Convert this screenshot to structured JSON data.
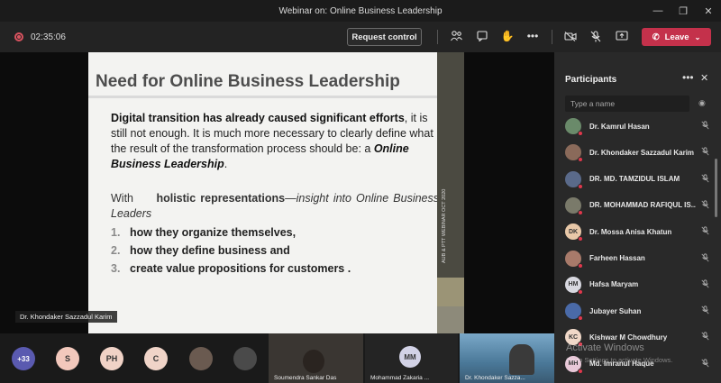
{
  "window": {
    "title": "Webinar on: Online Business Leadership"
  },
  "toolbar": {
    "timer": "02:35:06",
    "request_control": "Request control",
    "leave": "Leave"
  },
  "slide": {
    "title": "Need  for Online Business Leadership",
    "para1_bold": "Digital transition has already caused significant efforts",
    "para1_rest": ", it is still not enough. It is much more necessary to clearly define what the result of the transformation process should be: a ",
    "para1_italic": "Online Business Leadership",
    "para1_end": ".",
    "para2_with": "With",
    "para2_bold": "holistic representations",
    "para2_dash": "—",
    "para2_italic": "insight into Online Business Leaders",
    "bullets": [
      {
        "num": "1.",
        "text": "how they organize themselves,"
      },
      {
        "num": "2.",
        "text": "how they define business and"
      },
      {
        "num": "3.",
        "text": "create value propositions for customers ."
      }
    ],
    "side_text": "AUB & PTT WEBINAR OCT 2020"
  },
  "presenter_label": "Dr. Khondaker Sazzadul Karim",
  "participants": {
    "title": "Participants",
    "search_placeholder": "Type a name",
    "list": [
      {
        "name": "Dr. Kamrul Hasan",
        "initials": "",
        "color": "#6a8a6a"
      },
      {
        "name": "Dr. Khondaker Sazzadul Karim",
        "initials": "",
        "color": "#8a6a5a"
      },
      {
        "name": "DR. MD. TAMZIDUL ISLAM",
        "initials": "",
        "color": "#5a6a8a"
      },
      {
        "name": "DR. MOHAMMAD RAFIQUL IS...",
        "initials": "",
        "color": "#7a7a6a"
      },
      {
        "name": "Dr. Mossa Anisa Khatun",
        "initials": "DK",
        "color": "#e8c8a8"
      },
      {
        "name": "Farheen Hassan",
        "initials": "",
        "color": "#a87a6a"
      },
      {
        "name": "Hafsa Maryam",
        "initials": "HM",
        "color": "#d8d8e0"
      },
      {
        "name": "Jubayer Suhan",
        "initials": "",
        "color": "#4a6aa8"
      },
      {
        "name": "Kishwar M Chowdhury",
        "initials": "KC",
        "color": "#f0d8c8"
      },
      {
        "name": "Md. Imranul Haque",
        "initials": "MH",
        "color": "#e8c8d8"
      }
    ]
  },
  "strip": {
    "more_count": "+33",
    "avatars": [
      "S",
      "PH",
      "C"
    ],
    "tiles": [
      {
        "label": "Soumendra Sankar Das"
      },
      {
        "label": "Mohammad Zakaria ..."
      },
      {
        "label": "Dr. Khondaker Sazza..."
      }
    ],
    "mm_initials": "MM"
  },
  "watermark": {
    "line1": "Activate Windows",
    "line2": "Go to Settings to activate Windows."
  }
}
